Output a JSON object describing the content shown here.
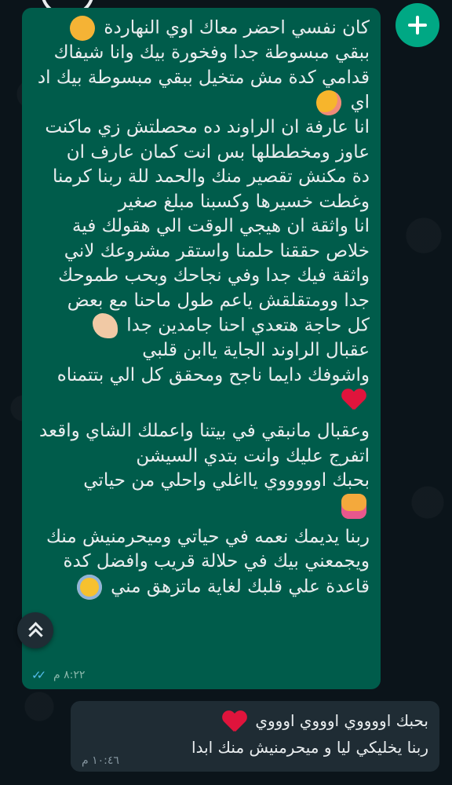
{
  "outgoing_message": {
    "lines": [
      "كان نفسي احضر معاك اوي النهاردة",
      "ببقي مبسوطة جدا وفخورة بيك وانا شيفاك",
      "قدامي كدة مش متخيل ببقي مبسوطة بيك اد",
      "اي",
      "انا عارفة ان الراوند ده محصلتش زي ماكنت",
      "عاوز ومخططلها بس انت كمان عارف ان",
      "دة مكنش تقصير منك والحمد للة ربنا كرمنا",
      "وغطت خسيرها وكسبنا مبلغ صغير",
      "انا واثقة ان هيجي الوقت الي هقولك فية",
      "خلاص حققنا حلمنا واستقر مشروعك لاني",
      "واثقة فيك جدا وفي نجاحك وبحب طموحك",
      "جدا وومتقلقش ياعم طول ماحنا مع بعض",
      "كل حاجة هتعدي احنا جامدين جدا",
      "عقبال الراوند الجاية ياابن قلبي",
      "واشوفك دايما ناجح ومحقق كل الي بتتمناه",
      "وعقبال مانبقي في بيتنا واعملك الشاي واقعد",
      "اتفرج عليك وانت بتدي السيشن",
      "بحبك اوووووي يااغلي واحلي من حياتي",
      "ربنا يديمك نعمه في حياتي وميحرمنيش منك",
      "ويجمعني بيك في حلالة قريب وافضل كدة",
      "قاعدة علي قلبك لغاية ماتزهق مني"
    ],
    "emojis": {
      "pensive": "pensive-face-icon",
      "blush": "smiling-face-icon",
      "muscle": "flexed-biceps-icon",
      "heart": "red-heart-icon",
      "couple": "couple-with-heart-icon",
      "star": "star-struck-icon"
    },
    "time": "٨:٢٢ م",
    "status_icon": "double-check-icon"
  },
  "incoming_message": {
    "lines": [
      "بحبك اووووي اوووي اوووي",
      "ربنا يخليكي ليا و ميحرمنيش منك ابدا"
    ],
    "time": "١٠:٤٦ م"
  },
  "colors": {
    "outgoing_bubble": "#005c4b",
    "incoming_bubble": "#1f2c34",
    "background": "#0b141a",
    "accent": "#00a884",
    "read_ticks": "#53bdeb"
  }
}
